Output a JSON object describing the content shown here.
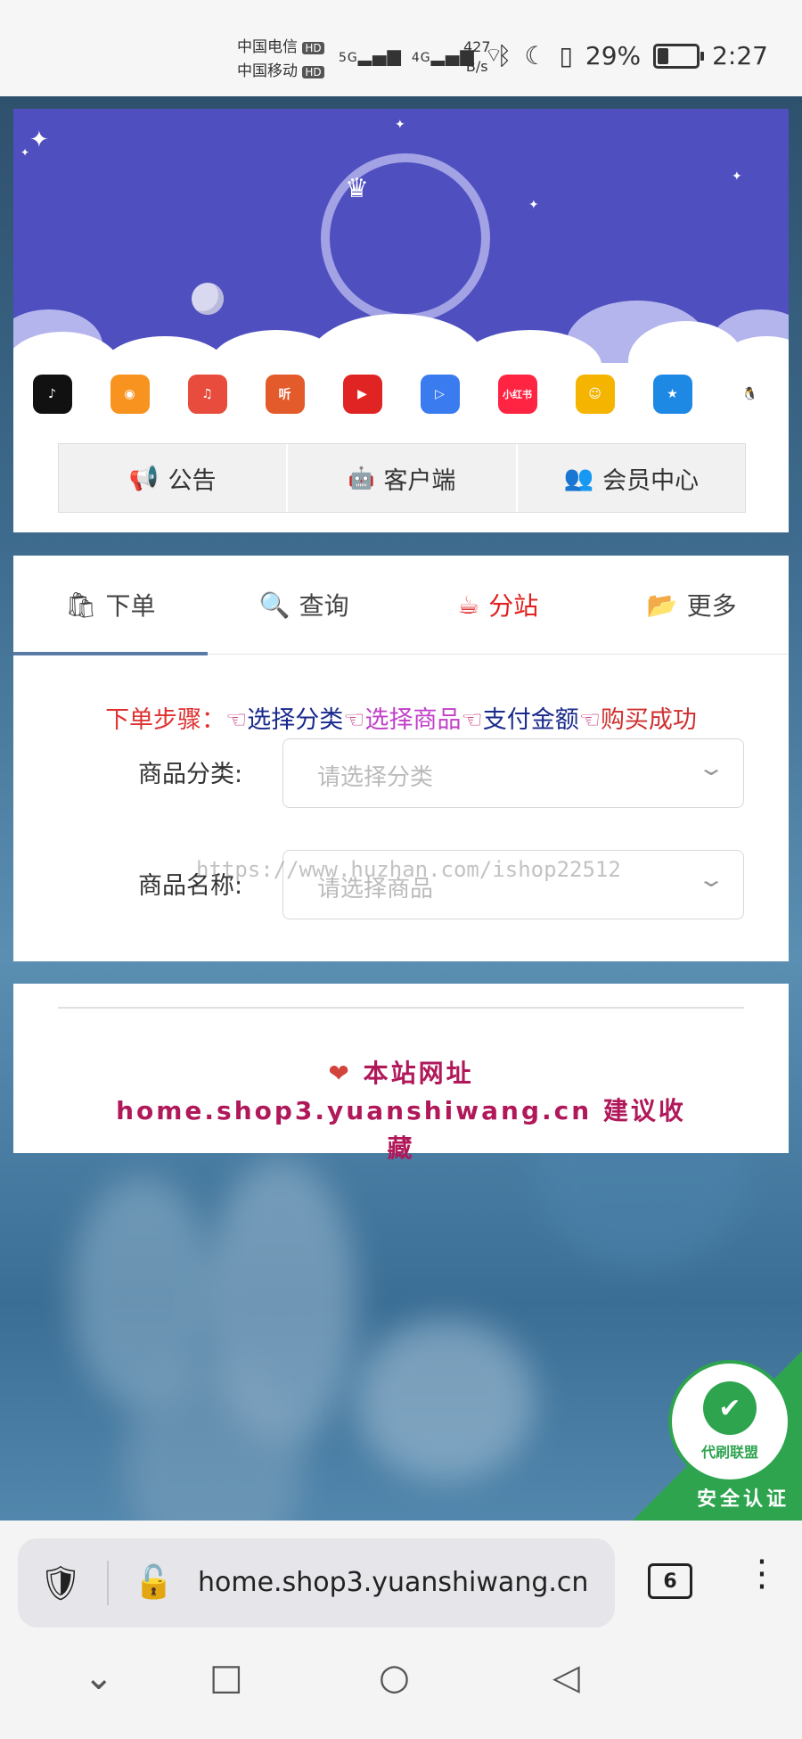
{
  "status_bar": {
    "carrier1": "中国电信",
    "carrier2": "中国移动",
    "hd": "HD",
    "net1": "5G",
    "net2": "4G",
    "speed_value": "427",
    "speed_unit": "B/s",
    "battery": "29%",
    "time": "2:27"
  },
  "header": {
    "app_icons": [
      {
        "name": "douyin",
        "color": "#111111",
        "glyph": "♪"
      },
      {
        "name": "kuaishou",
        "color": "#f7931e",
        "glyph": "◉"
      },
      {
        "name": "music",
        "color": "#e74c3c",
        "glyph": "♫"
      },
      {
        "name": "ting",
        "color": "#e35a2b",
        "glyph": "听"
      },
      {
        "name": "video",
        "color": "#e02424",
        "glyph": "▶"
      },
      {
        "name": "player",
        "color": "#3a7bf0",
        "glyph": "▷"
      },
      {
        "name": "xiaohongshu",
        "color": "#ff2442",
        "glyph": "小红书"
      },
      {
        "name": "character",
        "color": "#f4b400",
        "glyph": "☺"
      },
      {
        "name": "qzone",
        "color": "#1e88e5",
        "glyph": "★"
      },
      {
        "name": "qq",
        "color": "#ffffff",
        "glyph": "🐧"
      }
    ],
    "buttons": {
      "notice": "公告",
      "client": "客户端",
      "member": "会员中心"
    }
  },
  "order": {
    "tabs": {
      "order": "下单",
      "query": "查询",
      "substation": "分站",
      "more": "更多"
    },
    "steps": {
      "prefix": "下单步骤：",
      "hand": "☜",
      "s1": "选择分类",
      "s2": "选择商品",
      "s3": "支付金额",
      "s4": "购买成功"
    },
    "category_label": "商品分类:",
    "category_placeholder": "请选择分类",
    "product_label": "商品名称:",
    "product_placeholder": "请选择商品",
    "watermark": "https://www.huzhan.com/ishop22512"
  },
  "site_note": {
    "heart": "❤",
    "text": "本站网址 home.shop3.yuanshiwang.cn  建议收藏"
  },
  "badge": {
    "circle_label": "代刷联盟",
    "ribbon": "安全认证"
  },
  "browser": {
    "url": "home.shop3.yuanshiwang.cn",
    "tab_count": "6"
  }
}
